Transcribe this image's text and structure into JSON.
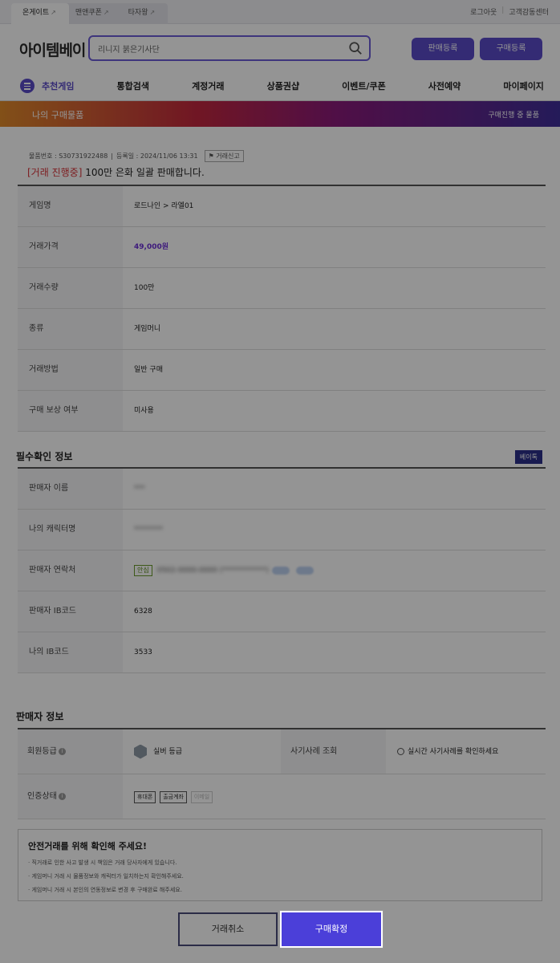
{
  "top_tabs": [
    {
      "label": "온게이트",
      "active": true
    },
    {
      "label": "맨앤쿠폰",
      "active": false
    },
    {
      "label": "타자왕",
      "active": false
    }
  ],
  "top_links": [
    "로그아웃",
    "고객감동센터"
  ],
  "logo": "아이템베이",
  "search": {
    "value": "리니지 붉은기사단"
  },
  "header_buttons": {
    "sell": "판매등록",
    "buy": "구매등록"
  },
  "nav": [
    "추천게임",
    "통합검색",
    "계정거래",
    "상품권샵",
    "이벤트/쿠폰",
    "사전예약",
    "마이페이지"
  ],
  "banner": {
    "title": "나의 구매물품",
    "right": "구매진행 중 물품"
  },
  "item": {
    "number": "물품번호 : S30731922488",
    "registered": "등록일 : 2024/11/06 13:31",
    "report": "거래신고",
    "status": "[거래 진행중]",
    "title": "100만 은화 일괄 판매합니다."
  },
  "details": [
    {
      "label": "게임명",
      "value": "로드나인 > 라엘01"
    },
    {
      "label": "거래가격",
      "value": "49,000원"
    },
    {
      "label": "거래수량",
      "value": "100만"
    },
    {
      "label": "종류",
      "value": "게임머니"
    },
    {
      "label": "거래방법",
      "value": "일반 구매"
    },
    {
      "label": "구매 보상 여부",
      "value": "미사용"
    }
  ],
  "required_info": {
    "title": "필수확인 정보",
    "badge": "베이톡",
    "rows": [
      {
        "label": "판매자 이름",
        "value": "***"
      },
      {
        "label": "나의 캐릭터명",
        "value": "********"
      },
      {
        "label": "판매자 연락처",
        "tag": "안심",
        "value": "0502-0000-0000 (************)"
      },
      {
        "label": "판매자 IB코드",
        "value": "6328"
      },
      {
        "label": "나의 IB코드",
        "value": "3533"
      }
    ]
  },
  "seller_info": {
    "title": "판매자 정보",
    "grade_label": "회원등급",
    "grade_value": "실버 등급",
    "fraud_label": "사기사례 조회",
    "fraud_value": "실시간 사기사례를 확인하세요",
    "auth_label": "인증상태",
    "auth_items": [
      {
        "label": "휴대폰",
        "on": true
      },
      {
        "label": "출금계좌",
        "on": true
      },
      {
        "label": "이메일",
        "on": false
      }
    ]
  },
  "notice": {
    "title": "안전거래를 위해 확인해 주세요!",
    "items": [
      "직거래로 인한 사고 발생 시 책임은 거래 당사자에게 있습니다.",
      "게임머니 거래 시 물품정보와 캐릭터가 일치하는지 확인해주세요.",
      "게임머니 거래 시 본인의 연동정보로 변경 후 구매완료 해주세요."
    ]
  },
  "buttons": {
    "cancel": "거래취소",
    "confirm": "구매확정"
  }
}
